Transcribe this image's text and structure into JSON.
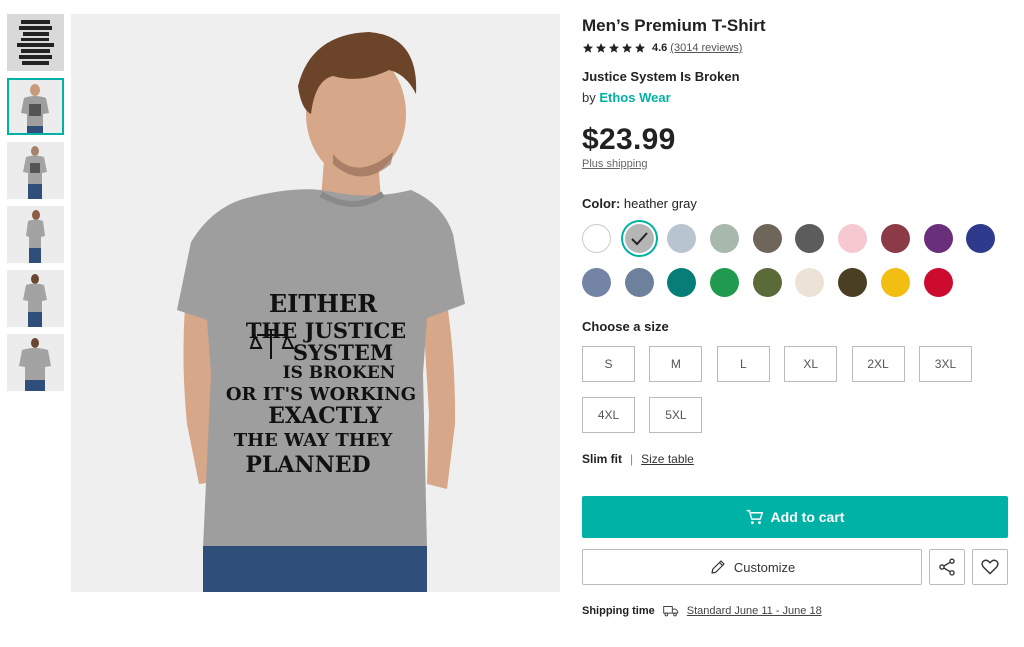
{
  "product": {
    "title": "Men’s Premium T-Shirt",
    "rating_value": "4.6",
    "reviews_text": "(3014 reviews)",
    "design_name": "Justice System Is Broken",
    "by_text": "by",
    "brand": "Ethos Wear",
    "price": "$23.99",
    "shipping_note": "Plus shipping"
  },
  "print_text": [
    "EITHER",
    "THE JUSTICE",
    "SYSTEM",
    "IS BROKEN",
    "OR IT'S WORKING",
    "EXACTLY",
    "THE WAY THEY",
    "PLANNED"
  ],
  "color": {
    "label": "Color:",
    "selected": "heather gray",
    "swatches": [
      "#ffffff",
      "#b5b5b5",
      "#b8c5d0",
      "#a9b8ad",
      "#6f665b",
      "#5c5c5c",
      "#f6c8d0",
      "#8b3a46",
      "#6a2f7a",
      "#2e3b8c",
      "#7384a6",
      "#6d819c",
      "#077d77",
      "#1f9a4e",
      "#5a6a38",
      "#ece3d6",
      "#4a3f22",
      "#f3be12",
      "#cc0b2f"
    ]
  },
  "size": {
    "label": "Choose a size",
    "options": [
      "S",
      "M",
      "L",
      "XL",
      "2XL",
      "3XL",
      "4XL",
      "5XL"
    ]
  },
  "fit": {
    "label": "Slim fit",
    "separator": "|",
    "size_table": "Size table"
  },
  "actions": {
    "add_to_cart": "Add to cart",
    "customize": "Customize"
  },
  "shipping": {
    "label": "Shipping time",
    "value": "Standard June 11 - June 18"
  },
  "colors": {
    "accent": "#00b2a5",
    "shirt": "#9e9e9e",
    "jeans": "#2f4f7a"
  },
  "icons": [
    "star-icon",
    "checkmark-icon",
    "cart-icon",
    "pencil-icon",
    "share-icon",
    "heart-icon",
    "truck-icon"
  ]
}
